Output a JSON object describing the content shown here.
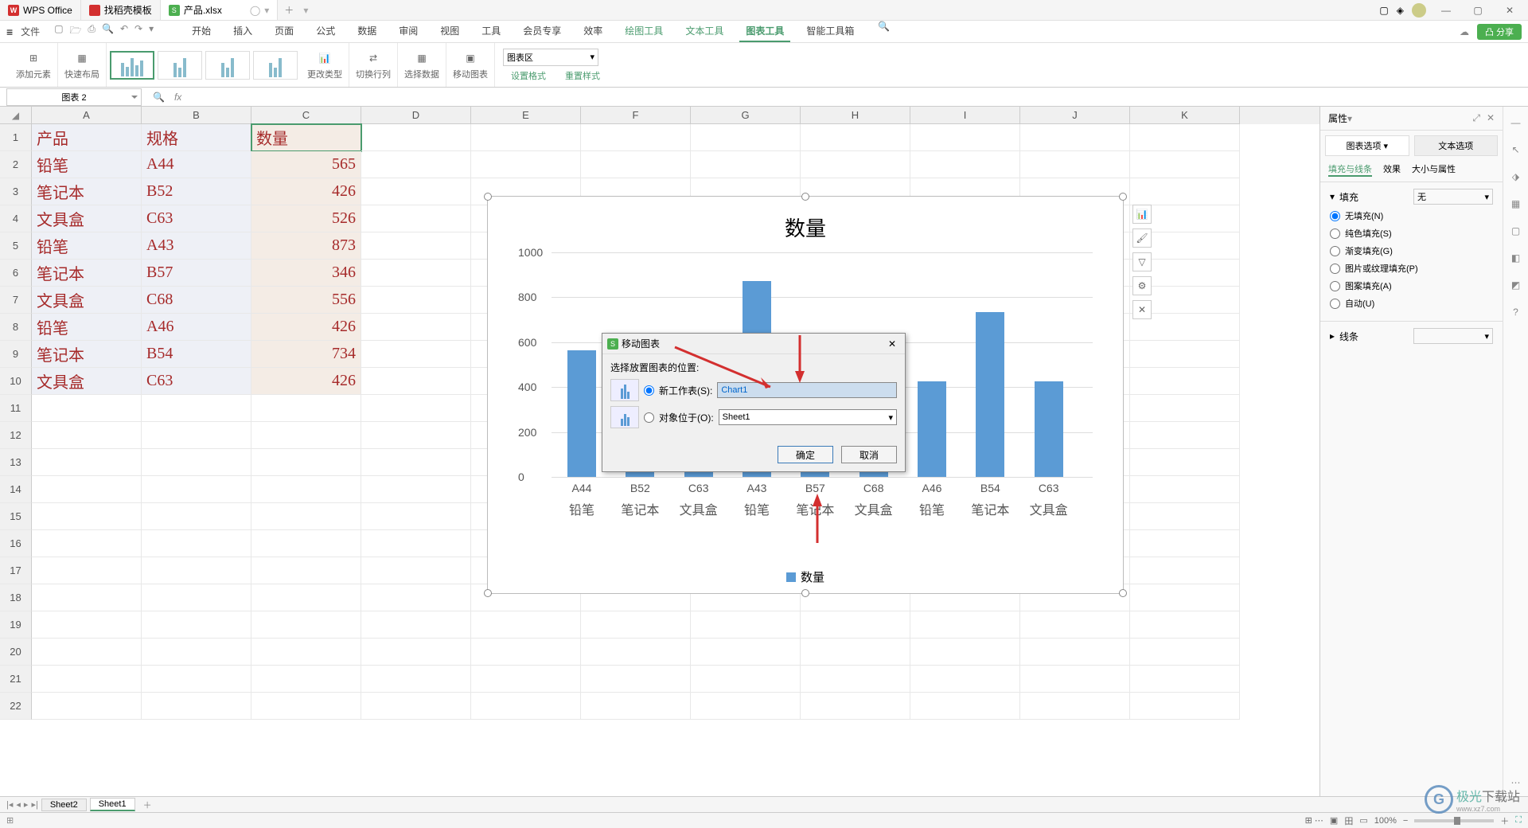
{
  "titlebar": {
    "tabs": [
      {
        "label": "WPS Office",
        "icon": "W"
      },
      {
        "label": "找稻壳模板",
        "icon": "D"
      },
      {
        "label": "产品.xlsx",
        "icon": "S",
        "active": true
      }
    ]
  },
  "menubar": {
    "file": "文件",
    "tabs": [
      "开始",
      "插入",
      "页面",
      "公式",
      "数据",
      "审阅",
      "视图",
      "工具",
      "会员专享",
      "效率",
      "绘图工具",
      "文本工具",
      "图表工具",
      "智能工具箱"
    ],
    "active_tab": "图表工具",
    "share": "分享"
  },
  "ribbon": {
    "add_element": "添加元素",
    "quick_layout": "快速布局",
    "change_type": "更改类型",
    "switch_rc": "切换行列",
    "select_data": "选择数据",
    "move_chart": "移动图表",
    "set_format": "设置格式",
    "reset_style": "重置样式",
    "chart_area": "图表区"
  },
  "formula": {
    "name_box": "图表 2"
  },
  "columns": [
    "A",
    "B",
    "C",
    "D",
    "E",
    "F",
    "G",
    "H",
    "I",
    "J",
    "K"
  ],
  "sheet": {
    "headers": [
      "产品",
      "规格",
      "数量"
    ],
    "rows": [
      {
        "a": "铅笔",
        "b": "A44",
        "c": "565"
      },
      {
        "a": "笔记本",
        "b": "B52",
        "c": "426"
      },
      {
        "a": "文具盒",
        "b": "C63",
        "c": "526"
      },
      {
        "a": "铅笔",
        "b": "A43",
        "c": "873"
      },
      {
        "a": "笔记本",
        "b": "B57",
        "c": "346"
      },
      {
        "a": "文具盒",
        "b": "C68",
        "c": "556"
      },
      {
        "a": "铅笔",
        "b": "A46",
        "c": "426"
      },
      {
        "a": "笔记本",
        "b": "B54",
        "c": "734"
      },
      {
        "a": "文具盒",
        "b": "C63",
        "c": "426"
      }
    ]
  },
  "chart_data": {
    "type": "bar",
    "title": "数量",
    "categories": [
      "A44",
      "B52",
      "C63",
      "A43",
      "B57",
      "C68",
      "A46",
      "B54",
      "C63"
    ],
    "categories2": [
      "铅笔",
      "笔记本",
      "文具盒",
      "铅笔",
      "笔记本",
      "文具盒",
      "铅笔",
      "笔记本",
      "文具盒"
    ],
    "values": [
      565,
      426,
      526,
      873,
      346,
      556,
      426,
      734,
      426
    ],
    "ylim": [
      0,
      1000
    ],
    "yticks": [
      0,
      200,
      400,
      600,
      800,
      1000
    ],
    "legend": "数量"
  },
  "dialog": {
    "title": "移动图表",
    "prompt": "选择放置图表的位置:",
    "new_sheet": "新工作表(S):",
    "new_sheet_value": "Chart1",
    "object_in": "对象位于(O):",
    "object_value": "Sheet1",
    "ok": "确定",
    "cancel": "取消"
  },
  "properties": {
    "header": "属性",
    "tab1": "图表选项",
    "tab2": "文本选项",
    "subtab1": "填充与线条",
    "subtab2": "效果",
    "subtab3": "大小与属性",
    "fill_header": "填充",
    "fill_select": "无",
    "fill_none": "无填充(N)",
    "fill_solid": "纯色填充(S)",
    "fill_gradient": "渐变填充(G)",
    "fill_picture": "图片或纹理填充(P)",
    "fill_pattern": "图案填充(A)",
    "fill_auto": "自动(U)",
    "line_header": "线条"
  },
  "sheet_tabs": {
    "tabs": [
      "Sheet2",
      "Sheet1"
    ],
    "active": "Sheet1"
  },
  "status": {
    "zoom": "100%"
  },
  "watermark": {
    "name": "极光下载站",
    "sub": "www.xz7.com"
  }
}
